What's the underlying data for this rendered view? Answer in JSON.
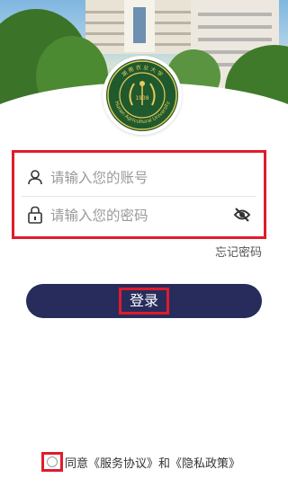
{
  "emblem": {
    "year": "1938",
    "latin_text": "Hunan Agricultural University",
    "chinese_text": "湖 南 农 业 大 学"
  },
  "login": {
    "account_placeholder": "请输入您的账号",
    "password_placeholder": "请输入您的密码",
    "forgot_label": "忘记密码",
    "login_label": "登录"
  },
  "agreement": {
    "prefix": "同意",
    "service_link": "《服务协议》",
    "and": "和",
    "privacy_link": "《隐私政策》"
  },
  "icons": {
    "account": "user-icon",
    "password": "lock-icon",
    "toggle_visibility": "eye-off-icon",
    "agree_checkbox": "radio-circle-icon"
  },
  "colors": {
    "primary": "#272c5c",
    "highlight": "#e01b2b",
    "placeholder": "#9a9a9a"
  }
}
